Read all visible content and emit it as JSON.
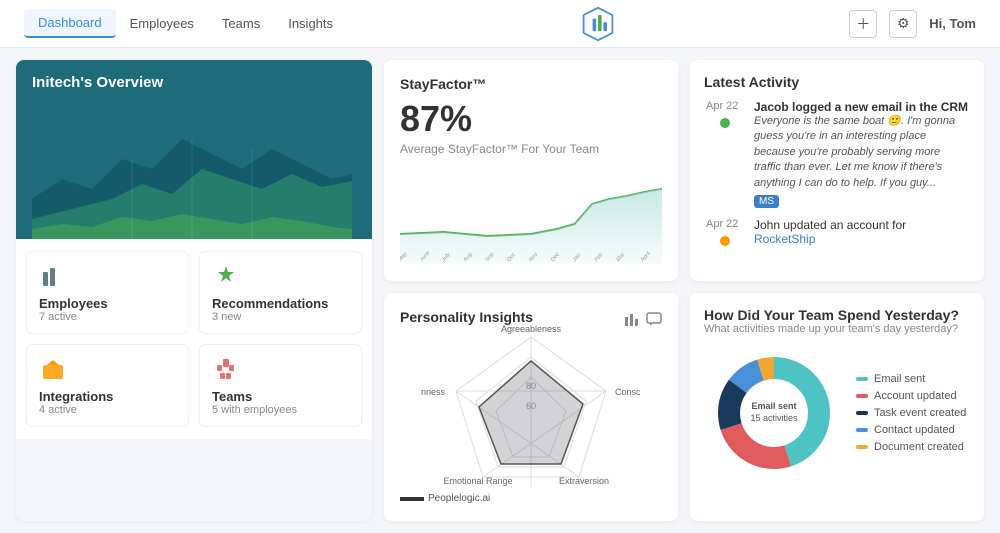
{
  "header": {
    "nav": [
      {
        "label": "Dashboard",
        "active": true
      },
      {
        "label": "Employees",
        "active": false
      },
      {
        "label": "Teams",
        "active": false
      },
      {
        "label": "Insights",
        "active": false
      }
    ],
    "greeting": "Hi,",
    "username": "Tom"
  },
  "overview": {
    "title": "Initech's Overview",
    "stats": [
      {
        "icon": "employees-icon",
        "label": "Employees",
        "sub": "7 active",
        "iconColor": "#607d8b"
      },
      {
        "icon": "recommendations-icon",
        "label": "Recommendations",
        "sub": "3 new",
        "iconColor": "#4caf50"
      },
      {
        "icon": "integrations-icon",
        "label": "Integrations",
        "sub": "4 active",
        "iconColor": "#ff9800"
      },
      {
        "icon": "teams-icon",
        "label": "Teams",
        "sub": "5 with employees",
        "iconColor": "#e57373"
      }
    ]
  },
  "stayfactor": {
    "title": "StayFactor™",
    "percentage": "87%",
    "label": "Average StayFactor™ For Your Team",
    "months": [
      "May",
      "June",
      "July",
      "August",
      "September",
      "October",
      "November",
      "December",
      "January",
      "February",
      "March",
      "April"
    ]
  },
  "activity": {
    "title": "Latest Activity",
    "items": [
      {
        "date": "Apr 22",
        "text": "Jacob logged a new email in the CRM",
        "quote": "Everyone is the same boat 🙂. I'm gonna guess you're in an interesting place because you're probably serving more traffic than ever. Let me know if there's anything I can do to help. If you guy...",
        "badge": "MS",
        "dotColor": "green"
      },
      {
        "date": "Apr 22",
        "text": "John updated an account for",
        "link": "RocketShip",
        "dotColor": "orange"
      }
    ]
  },
  "personality": {
    "title": "Personality Insights",
    "axes": [
      "Agreeableness",
      "Conscientiousness",
      "Extraversion",
      "Emotional Range",
      "Openness"
    ],
    "center_label": "60",
    "outer_label": "80",
    "footer": "Peoplelogic.ai"
  },
  "spend": {
    "title": "How Did Your Team Spend Yesterday?",
    "subtitle": "What activities made up your team's day yesterday?",
    "center_label": "Email sent",
    "center_sub": "15 activities",
    "legend": [
      {
        "label": "Email sent",
        "color": "#4fc3c3"
      },
      {
        "label": "Account updated",
        "color": "#e05c5c"
      },
      {
        "label": "Task event created",
        "color": "#1a3a5c"
      },
      {
        "label": "Contact updated",
        "color": "#4a90d9"
      },
      {
        "label": "Document created",
        "color": "#f0a830"
      }
    ],
    "donut": {
      "segments": [
        {
          "value": 45,
          "color": "#4fc3c3"
        },
        {
          "value": 25,
          "color": "#e05c5c"
        },
        {
          "value": 15,
          "color": "#1a3a5c"
        },
        {
          "value": 10,
          "color": "#4a90d9"
        },
        {
          "value": 5,
          "color": "#f0a830"
        }
      ]
    }
  }
}
